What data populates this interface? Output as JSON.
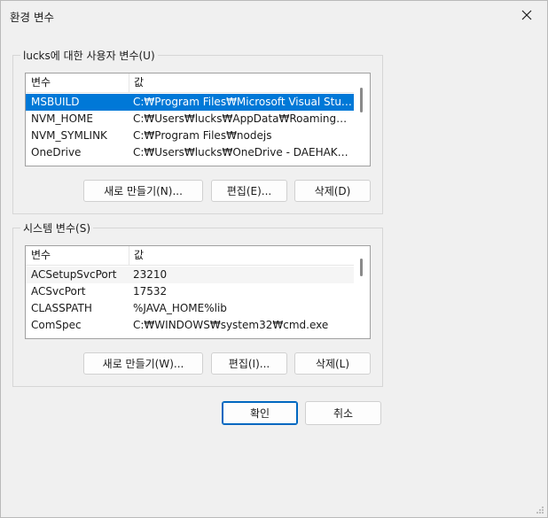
{
  "window": {
    "title": "환경 변수"
  },
  "user_group": {
    "label": "lucks에 대한 사용자 변수(U)",
    "columns": [
      "변수",
      "값"
    ],
    "rows": [
      {
        "name": "MSBUILD",
        "value": "C:₩Program Files₩Microsoft Visual Studio..."
      },
      {
        "name": "NVM_HOME",
        "value": "C:₩Users₩lucks₩AppData₩Roaming₩nvm"
      },
      {
        "name": "NVM_SYMLINK",
        "value": "C:₩Program Files₩nodejs"
      },
      {
        "name": "OneDrive",
        "value": "C:₩Users₩lucks₩OneDrive - DAEHAKNAEIL"
      }
    ],
    "buttons": {
      "new": "새로 만들기(N)...",
      "edit": "편집(E)...",
      "delete": "삭제(D)"
    }
  },
  "system_group": {
    "label": "시스템 변수(S)",
    "columns": [
      "변수",
      "값"
    ],
    "rows": [
      {
        "name": "ACSetupSvcPort",
        "value": "23210"
      },
      {
        "name": "ACSvcPort",
        "value": "17532"
      },
      {
        "name": "CLASSPATH",
        "value": "%JAVA_HOME%lib"
      },
      {
        "name": "ComSpec",
        "value": "C:₩WINDOWS₩system32₩cmd.exe"
      }
    ],
    "buttons": {
      "new": "새로 만들기(W)...",
      "edit": "편집(I)...",
      "delete": "삭제(L)"
    }
  },
  "dialog_buttons": {
    "ok": "확인",
    "cancel": "취소"
  }
}
